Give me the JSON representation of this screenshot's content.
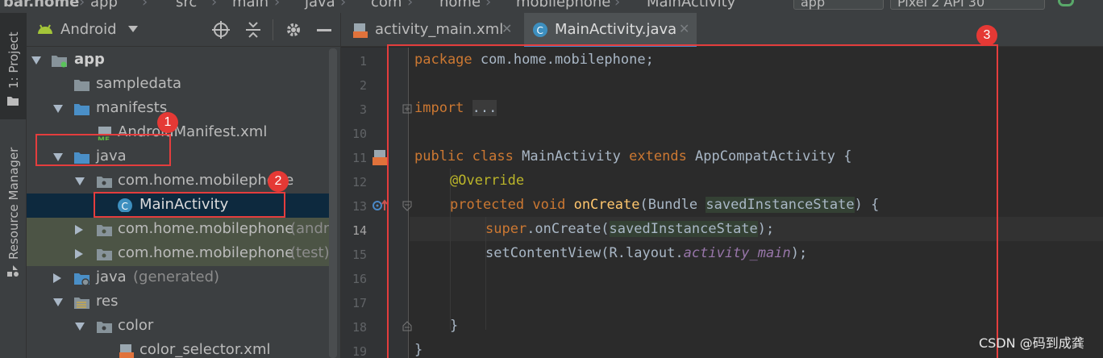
{
  "breadcrumbs": {
    "items": [
      "bar.home",
      "app",
      "src",
      "main",
      "java",
      "com",
      "home",
      "mobilephone",
      "MainActivity"
    ],
    "run_config": "app",
    "device": "Pixel 2 API 30"
  },
  "left_strip": {
    "project_tab": "1: Project",
    "resource_tab": "Resource Manager"
  },
  "project_panel": {
    "view_selector": "Android",
    "tree": [
      {
        "label": "app",
        "bold": true
      },
      {
        "label": "sampledata"
      },
      {
        "label": "manifests"
      },
      {
        "label": "AndroidManifest.xml"
      },
      {
        "label": "java"
      },
      {
        "label": "com.home.mobilephone"
      },
      {
        "label": "MainActivity"
      },
      {
        "label": "com.home.mobilephone",
        "suffix": "(androidTest)"
      },
      {
        "label": "com.home.mobilephone",
        "suffix": "(test)"
      },
      {
        "label": "java",
        "suffix": "(generated)"
      },
      {
        "label": "res"
      },
      {
        "label": "color"
      },
      {
        "label": "color_selector.xml"
      }
    ]
  },
  "editor": {
    "tabs": [
      {
        "label": "activity_main.xml",
        "active": false
      },
      {
        "label": "MainActivity.java",
        "active": true
      }
    ],
    "line_numbers": [
      "1",
      "2",
      "3",
      "10",
      "11",
      "12",
      "13",
      "14",
      "15",
      "16",
      "17",
      "18",
      "19"
    ],
    "current_line": "14",
    "code": {
      "l1_kw": "package",
      "l1_rest": " com.home.mobilephone;",
      "l3_kw": "import",
      "l3_fold": "...",
      "l11_kw1": "public",
      "l11_kw2": "class",
      "l11_name": " MainActivity ",
      "l11_kw3": "extends",
      "l11_rest": " AppCompatActivity {",
      "l12_ann": "@Override",
      "l13_kw1": "protected",
      "l13_kw2": "void",
      "l13_fn": "onCreate",
      "l13_open": "(Bundle ",
      "l13_param": "savedInstanceState",
      "l13_close": ") {",
      "l14_kw": "super",
      "l14_rest": ".onCreate(",
      "l14_param": "savedInstanceState",
      "l14_end": ");",
      "l15_call": "setContentView(R.layout.",
      "l15_field": "activity_main",
      "l15_end": ");",
      "l18_brace": "}",
      "l19_brace": "}"
    }
  },
  "annotations": {
    "marker1": "1",
    "marker2": "2",
    "marker3": "3"
  },
  "watermark": "CSDN @码到成龚",
  "colors": {
    "annotation_red": "#e43d3d",
    "keyword": "#cc7832",
    "selection": "#0d293e"
  }
}
